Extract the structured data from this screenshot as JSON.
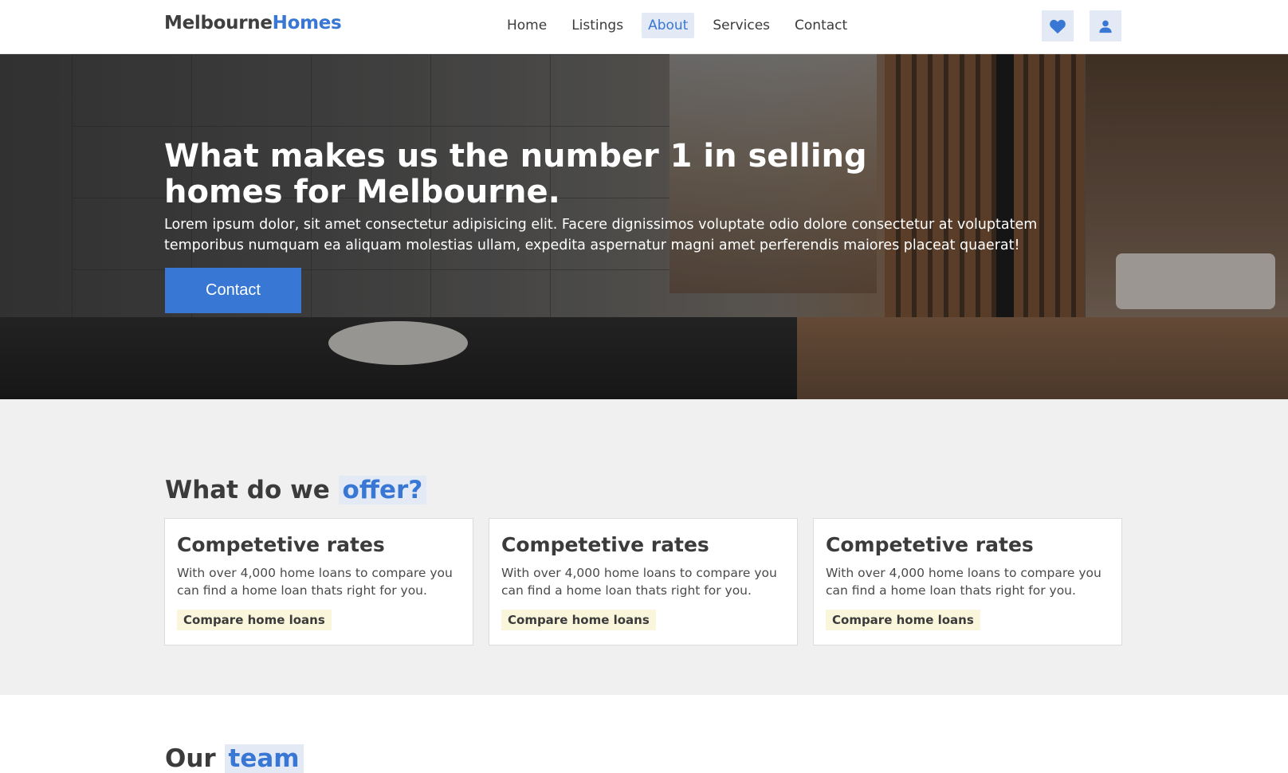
{
  "brand": {
    "part1": "Melbourne",
    "part2": "Homes"
  },
  "nav": {
    "links": [
      {
        "label": "Home"
      },
      {
        "label": "Listings"
      },
      {
        "label": "About"
      },
      {
        "label": "Services"
      },
      {
        "label": "Contact"
      }
    ],
    "active": "About"
  },
  "icons": {
    "favorites": "heart-icon",
    "account": "user-icon"
  },
  "colors": {
    "accent": "#3877d4",
    "accent_bg": "#e3e9f5",
    "link_bg": "#faf6dc",
    "section_bg": "#f0f0f0"
  },
  "hero": {
    "title": "What makes us the number 1 in selling homes for Melbourne.",
    "text": "Lorem ipsum dolor, sit amet consectetur adipisicing elit. Facere dignissimos voluptate odio dolore consectetur at voluptatem temporibus numquam ea aliquam molestias ullam, expedita aspernatur magni amet perferendis maiores placeat quaerat!",
    "button": "Contact"
  },
  "offer": {
    "title_plain": "What do we",
    "title_highlight": "offer?",
    "cards": [
      {
        "title": "Competetive rates",
        "text": "With over 4,000 home loans to compare you can find a home loan thats right for you.",
        "link": "Compare home loans"
      },
      {
        "title": "Competetive rates",
        "text": "With over 4,000 home loans to compare you can find a home loan thats right for you.",
        "link": "Compare home loans"
      },
      {
        "title": "Competetive rates",
        "text": "With over 4,000 home loans to compare you can find a home loan thats right for you.",
        "link": "Compare home loans"
      }
    ]
  },
  "team": {
    "title_plain": "Our",
    "title_highlight": "team"
  }
}
